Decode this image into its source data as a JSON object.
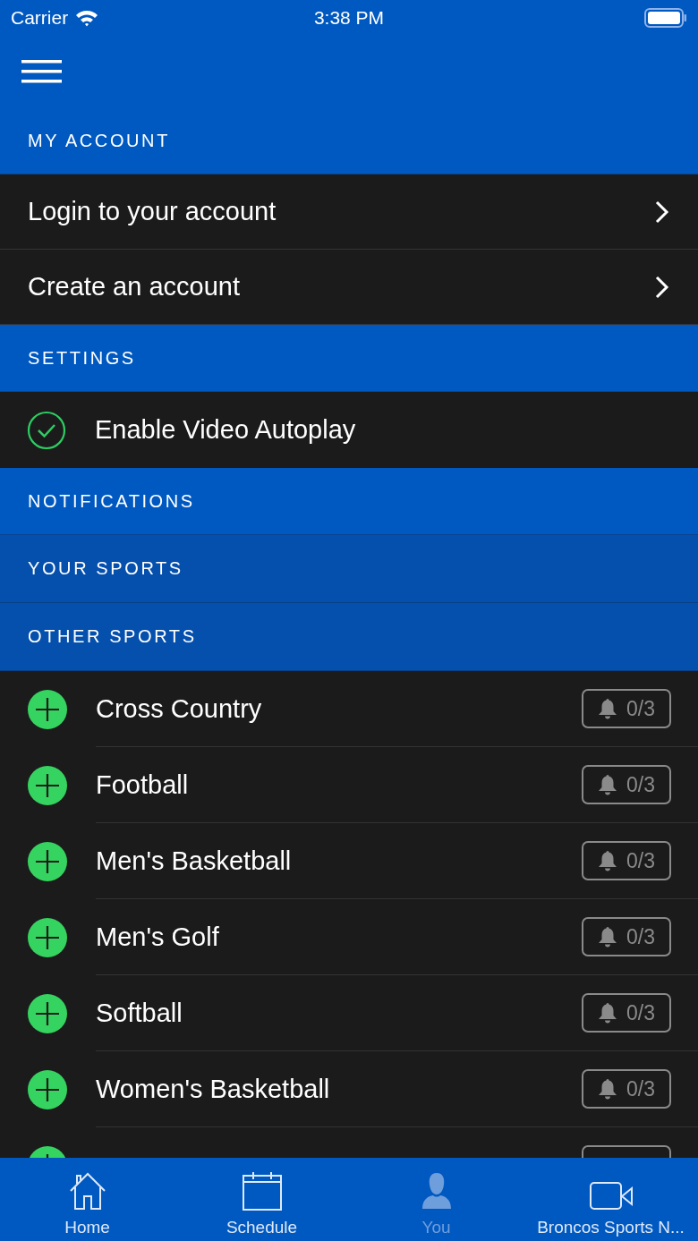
{
  "status_bar": {
    "carrier": "Carrier",
    "time": "3:38 PM"
  },
  "sections": [
    {
      "title": "MY ACCOUNT",
      "kind": "main",
      "items": [
        {
          "kind": "link",
          "label": "Login to your account"
        },
        {
          "kind": "link",
          "label": "Create an account"
        }
      ]
    },
    {
      "title": "SETTINGS",
      "kind": "main",
      "items": [
        {
          "kind": "toggle",
          "label": "Enable Video Autoplay",
          "checked": true
        }
      ]
    },
    {
      "title": "NOTIFICATIONS",
      "kind": "main"
    },
    {
      "title": "YOUR SPORTS",
      "kind": "sub"
    },
    {
      "title": "OTHER SPORTS",
      "kind": "sub",
      "items": [
        {
          "kind": "sport",
          "label": "Cross Country",
          "count": "0/3"
        },
        {
          "kind": "sport",
          "label": "Football",
          "count": "0/3"
        },
        {
          "kind": "sport",
          "label": "Men's Basketball",
          "count": "0/3"
        },
        {
          "kind": "sport",
          "label": "Men's Golf",
          "count": "0/3"
        },
        {
          "kind": "sport",
          "label": "Softball",
          "count": "0/3"
        },
        {
          "kind": "sport",
          "label": "Women's Basketball",
          "count": "0/3"
        },
        {
          "kind": "sport_partial"
        }
      ]
    }
  ],
  "tabs": [
    {
      "label": "Home",
      "selected": false
    },
    {
      "label": "Schedule",
      "selected": false
    },
    {
      "label": "You",
      "selected": true
    },
    {
      "label": "Broncos Sports N..."
    }
  ]
}
